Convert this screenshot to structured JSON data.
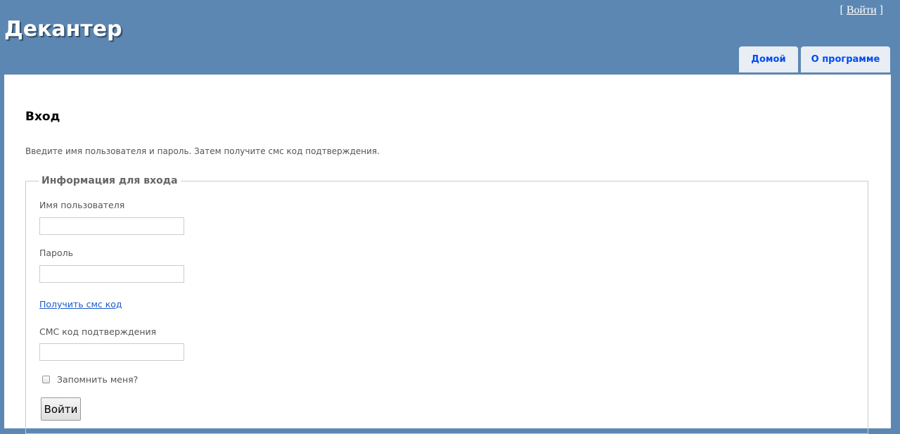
{
  "header": {
    "app_title": "Декантер",
    "login": {
      "bracket_open": "[",
      "link_label": "Войти",
      "bracket_close": "]"
    },
    "menu": {
      "home": "Домой",
      "about": "О программе"
    }
  },
  "main": {
    "heading": "Вход",
    "intro": "Введите имя пользователя и пароль. Затем получите смс код подтверждения.",
    "form": {
      "legend": "Информация для входа",
      "username_label": "Имя пользователя",
      "username_value": "",
      "password_label": "Пароль",
      "password_value": "",
      "sms_link": "Получить смс код",
      "sms_code_label": "СМС код подтверждения",
      "sms_code_value": "",
      "remember_label": "Запомнить меня?",
      "remember_checked": false,
      "submit_label": "Войти"
    }
  },
  "colors": {
    "page_background": "#5c87b2",
    "tab_background": "#e8eef4",
    "tab_text": "#034af3",
    "link": "#1a5ac8"
  }
}
